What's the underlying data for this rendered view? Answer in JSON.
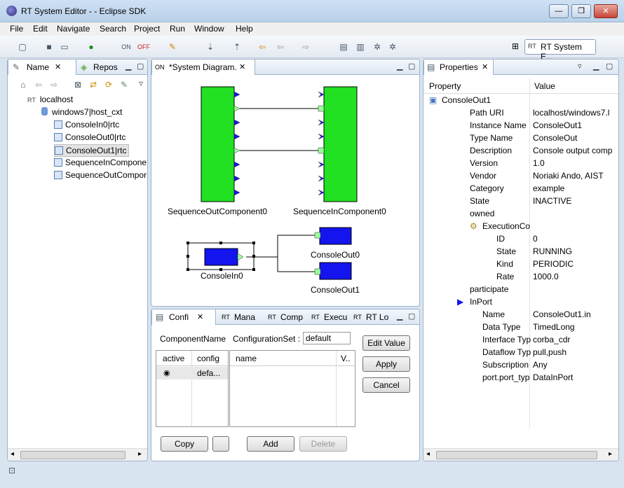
{
  "window": {
    "title": "RT System Editor - - Eclipse SDK",
    "min": "—",
    "max": "❐",
    "close": "✕"
  },
  "menu": [
    "File",
    "Edit",
    "Navigate",
    "Search",
    "Project",
    "Run",
    "Window",
    "Help"
  ],
  "perspective": {
    "label": "RT System E..."
  },
  "left_panel": {
    "tabs": [
      "Name",
      "Repos"
    ],
    "tree": {
      "root": "localhost",
      "host": "windows7|host_cxt",
      "items": [
        "ConsoleIn0|rtc",
        "ConsoleOut0|rtc",
        "ConsoleOut1|rtc",
        "SequenceInCompone",
        "SequenceOutCompor"
      ]
    }
  },
  "diagram": {
    "tab": "*System Diagram.",
    "components": [
      "SequenceOutComponent0",
      "SequenceInComponent0",
      "ConsoleIn0",
      "ConsoleOut0",
      "ConsoleOut1"
    ]
  },
  "config": {
    "tabs": [
      "Confi",
      "Mana",
      "Comp",
      "Execu",
      "RT Lo"
    ],
    "component_name_label": "ComponentName",
    "config_set_label": "ConfigurationSet :",
    "config_set_value": "default",
    "left_table": {
      "headers": [
        "active",
        "config"
      ],
      "row": "defa..."
    },
    "right_table": {
      "headers": [
        "name",
        "V.."
      ]
    },
    "buttons": {
      "edit_value": "Edit Value",
      "apply": "Apply",
      "cancel": "Cancel",
      "copy": "Copy",
      "add": "Add",
      "delete": "Delete"
    }
  },
  "properties": {
    "tab": "Properties",
    "headers": [
      "Property",
      "Value"
    ],
    "rows": [
      {
        "k": "ConsoleOut1",
        "v": "",
        "indent": 1,
        "icon": "component-icon"
      },
      {
        "k": "Path URI",
        "v": "localhost/windows7.l",
        "indent": 2
      },
      {
        "k": "Instance Name",
        "v": "ConsoleOut1",
        "indent": 2
      },
      {
        "k": "Type Name",
        "v": "ConsoleOut",
        "indent": 2
      },
      {
        "k": "Description",
        "v": "Console output comp",
        "indent": 2
      },
      {
        "k": "Version",
        "v": "1.0",
        "indent": 2
      },
      {
        "k": "Vendor",
        "v": "Noriaki Ando, AIST",
        "indent": 2
      },
      {
        "k": "Category",
        "v": "example",
        "indent": 2
      },
      {
        "k": "State",
        "v": "INACTIVE",
        "indent": 2
      },
      {
        "k": "owned",
        "v": "",
        "indent": 2
      },
      {
        "k": "ExecutionCo",
        "v": "",
        "indent": 3,
        "icon": "gears-icon"
      },
      {
        "k": "ID",
        "v": "0",
        "indent": 4
      },
      {
        "k": "State",
        "v": "RUNNING",
        "indent": 4
      },
      {
        "k": "Kind",
        "v": "PERIODIC",
        "indent": 4
      },
      {
        "k": "Rate",
        "v": "1000.0",
        "indent": 4
      },
      {
        "k": "participate",
        "v": "",
        "indent": 2
      },
      {
        "k": "InPort",
        "v": "",
        "indent": 2,
        "icon": "inport-icon"
      },
      {
        "k": "Name",
        "v": "ConsoleOut1.in",
        "indent": 3
      },
      {
        "k": "Data Type",
        "v": "TimedLong",
        "indent": 3
      },
      {
        "k": "Interface Typ",
        "v": "corba_cdr",
        "indent": 3
      },
      {
        "k": "Dataflow Typ",
        "v": "pull,push",
        "indent": 3
      },
      {
        "k": "Subscription",
        "v": "Any",
        "indent": 3
      },
      {
        "k": "port.port_typ",
        "v": "DataInPort",
        "indent": 3
      }
    ]
  },
  "colors": {
    "component_fill": "#22e022",
    "port_fill": "#1414ef",
    "accent": "#3c6fb6"
  }
}
